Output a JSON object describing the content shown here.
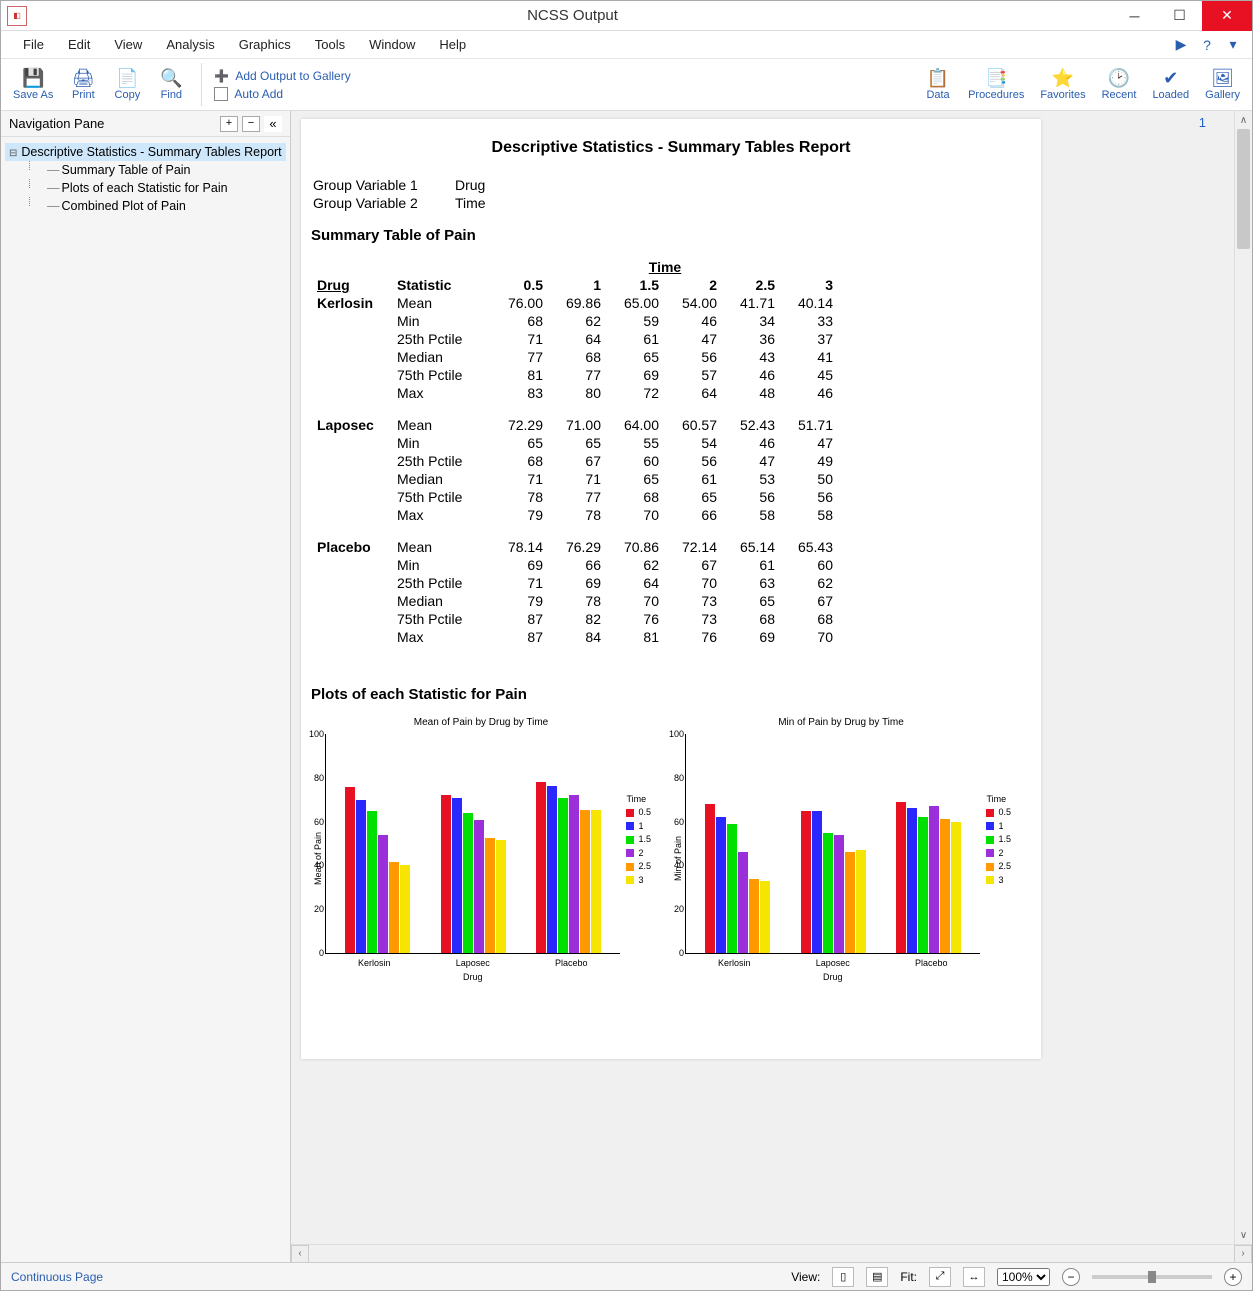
{
  "window": {
    "title": "NCSS Output"
  },
  "menu": [
    "File",
    "Edit",
    "View",
    "Analysis",
    "Graphics",
    "Tools",
    "Window",
    "Help"
  ],
  "toolbar": {
    "left": [
      {
        "icon": "💾",
        "label": "Save As"
      },
      {
        "icon": "🖨",
        "label": "Print"
      },
      {
        "icon": "📄",
        "label": "Copy"
      },
      {
        "icon": "🔍",
        "label": "Find"
      }
    ],
    "add_gallery": "Add Output to Gallery",
    "auto_add": "Auto Add",
    "right": [
      {
        "icon": "📋",
        "label": "Data"
      },
      {
        "icon": "📑",
        "label": "Procedures"
      },
      {
        "icon": "⭐",
        "label": "Favorites"
      },
      {
        "icon": "🕑",
        "label": "Recent"
      },
      {
        "icon": "✔",
        "label": "Loaded"
      },
      {
        "icon": "🖼",
        "label": "Gallery"
      }
    ]
  },
  "nav": {
    "title": "Navigation Pane",
    "root": "Descriptive Statistics - Summary Tables Report",
    "children": [
      "Summary Table of Pain",
      "Plots of each Statistic for Pain",
      "Combined Plot of Pain"
    ]
  },
  "page_number": "1",
  "report": {
    "title": "Descriptive Statistics - Summary Tables Report",
    "meta": [
      [
        "Group Variable 1",
        "Drug"
      ],
      [
        "Group Variable 2",
        "Time"
      ]
    ],
    "section1": "Summary Table of Pain",
    "col_group_label": "Time",
    "row_group_label": "Drug",
    "stat_label": "Statistic",
    "time_cols": [
      "0.5",
      "1",
      "1.5",
      "2",
      "2.5",
      "3"
    ],
    "stats": [
      "Mean",
      "Min",
      "25th Pctile",
      "Median",
      "75th Pctile",
      "Max"
    ],
    "groups": [
      {
        "name": "Kerlosin",
        "rows": [
          [
            "76.00",
            "69.86",
            "65.00",
            "54.00",
            "41.71",
            "40.14"
          ],
          [
            "68",
            "62",
            "59",
            "46",
            "34",
            "33"
          ],
          [
            "71",
            "64",
            "61",
            "47",
            "36",
            "37"
          ],
          [
            "77",
            "68",
            "65",
            "56",
            "43",
            "41"
          ],
          [
            "81",
            "77",
            "69",
            "57",
            "46",
            "45"
          ],
          [
            "83",
            "80",
            "72",
            "64",
            "48",
            "46"
          ]
        ]
      },
      {
        "name": "Laposec",
        "rows": [
          [
            "72.29",
            "71.00",
            "64.00",
            "60.57",
            "52.43",
            "51.71"
          ],
          [
            "65",
            "65",
            "55",
            "54",
            "46",
            "47"
          ],
          [
            "68",
            "67",
            "60",
            "56",
            "47",
            "49"
          ],
          [
            "71",
            "71",
            "65",
            "61",
            "53",
            "50"
          ],
          [
            "78",
            "77",
            "68",
            "65",
            "56",
            "56"
          ],
          [
            "79",
            "78",
            "70",
            "66",
            "58",
            "58"
          ]
        ]
      },
      {
        "name": "Placebo",
        "rows": [
          [
            "78.14",
            "76.29",
            "70.86",
            "72.14",
            "65.14",
            "65.43"
          ],
          [
            "69",
            "66",
            "62",
            "67",
            "61",
            "60"
          ],
          [
            "71",
            "69",
            "64",
            "70",
            "63",
            "62"
          ],
          [
            "79",
            "78",
            "70",
            "73",
            "65",
            "67"
          ],
          [
            "87",
            "82",
            "76",
            "73",
            "68",
            "68"
          ],
          [
            "87",
            "84",
            "81",
            "76",
            "69",
            "70"
          ]
        ]
      }
    ],
    "section2": "Plots of each Statistic for Pain"
  },
  "chart_data": [
    {
      "type": "bar",
      "title": "Mean of Pain by Drug by Time",
      "xlabel": "Drug",
      "ylabel": "Mean of Pain",
      "ylim": [
        0,
        100
      ],
      "yticks": [
        0,
        20,
        40,
        60,
        80,
        100
      ],
      "categories": [
        "Kerlosin",
        "Laposec",
        "Placebo"
      ],
      "legend_title": "Time",
      "series": [
        {
          "name": "0.5",
          "values": [
            76.0,
            72.29,
            78.14
          ]
        },
        {
          "name": "1",
          "values": [
            69.86,
            71.0,
            76.29
          ]
        },
        {
          "name": "1.5",
          "values": [
            65.0,
            64.0,
            70.86
          ]
        },
        {
          "name": "2",
          "values": [
            54.0,
            60.57,
            72.14
          ]
        },
        {
          "name": "2.5",
          "values": [
            41.71,
            52.43,
            65.14
          ]
        },
        {
          "name": "3",
          "values": [
            40.14,
            51.71,
            65.43
          ]
        }
      ]
    },
    {
      "type": "bar",
      "title": "Min of Pain by Drug by Time",
      "xlabel": "Drug",
      "ylabel": "Min of Pain",
      "ylim": [
        0,
        100
      ],
      "yticks": [
        0,
        20,
        40,
        60,
        80,
        100
      ],
      "categories": [
        "Kerlosin",
        "Laposec",
        "Placebo"
      ],
      "legend_title": "Time",
      "series": [
        {
          "name": "0.5",
          "values": [
            68,
            65,
            69
          ]
        },
        {
          "name": "1",
          "values": [
            62,
            65,
            66
          ]
        },
        {
          "name": "1.5",
          "values": [
            59,
            55,
            62
          ]
        },
        {
          "name": "2",
          "values": [
            46,
            54,
            67
          ]
        },
        {
          "name": "2.5",
          "values": [
            34,
            46,
            61
          ]
        },
        {
          "name": "3",
          "values": [
            33,
            47,
            60
          ]
        }
      ]
    }
  ],
  "status": {
    "mode": "Continuous Page",
    "view_label": "View:",
    "fit_label": "Fit:",
    "zoom": "100%"
  }
}
